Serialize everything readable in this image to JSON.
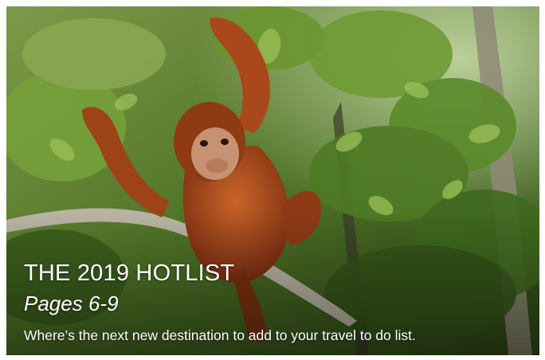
{
  "card": {
    "title": "THE 2019 HOTLIST",
    "pages": "Pages 6-9",
    "description": "Where’s the next new destination to add to your travel to do list."
  },
  "colors": {
    "caption_text": "#ffffff",
    "orangutan_fur": "#b5531d",
    "foliage": "#5f8a2e"
  }
}
